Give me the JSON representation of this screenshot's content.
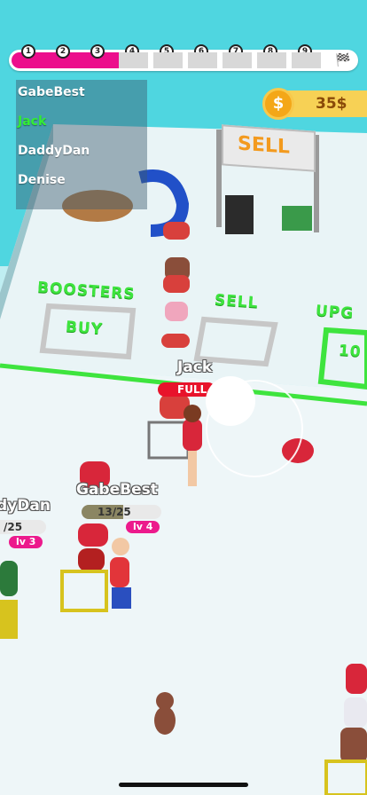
{
  "progress": {
    "levels": [
      "1",
      "2",
      "3",
      "4",
      "5",
      "6",
      "7",
      "8",
      "9"
    ],
    "completed": 3,
    "finish_icon": "checkered-flag-icon"
  },
  "leaderboard": [
    {
      "name": "GabeBest",
      "color": "#ffffff"
    },
    {
      "name": "Jack",
      "color": "#33ee33"
    },
    {
      "name": "DaddyDan",
      "color": "#ffffff"
    },
    {
      "name": "Denise",
      "color": "#ffffff"
    }
  ],
  "coins": {
    "amount": "35$",
    "icon": "dollar-coin-icon"
  },
  "zones": {
    "sell_sign": "SELL",
    "boosters": "BOOSTERS",
    "sell_floor": "SELL",
    "upgrade_partial": "UPG",
    "buy": "BUY",
    "upgrade_price_partial": "10"
  },
  "players": {
    "jack": {
      "name": "Jack",
      "status": "FULL"
    },
    "gabebest": {
      "name": "GabeBest",
      "capacity": "13/25",
      "capacity_fraction": 0.52,
      "level": "lv 4"
    },
    "daddydan": {
      "name": "dyDan",
      "capacity": "/25",
      "level": "lv 3"
    }
  },
  "colors": {
    "accent": "#ec0e8c",
    "floor_line": "#3ee43e",
    "coin": "#f4a718"
  }
}
